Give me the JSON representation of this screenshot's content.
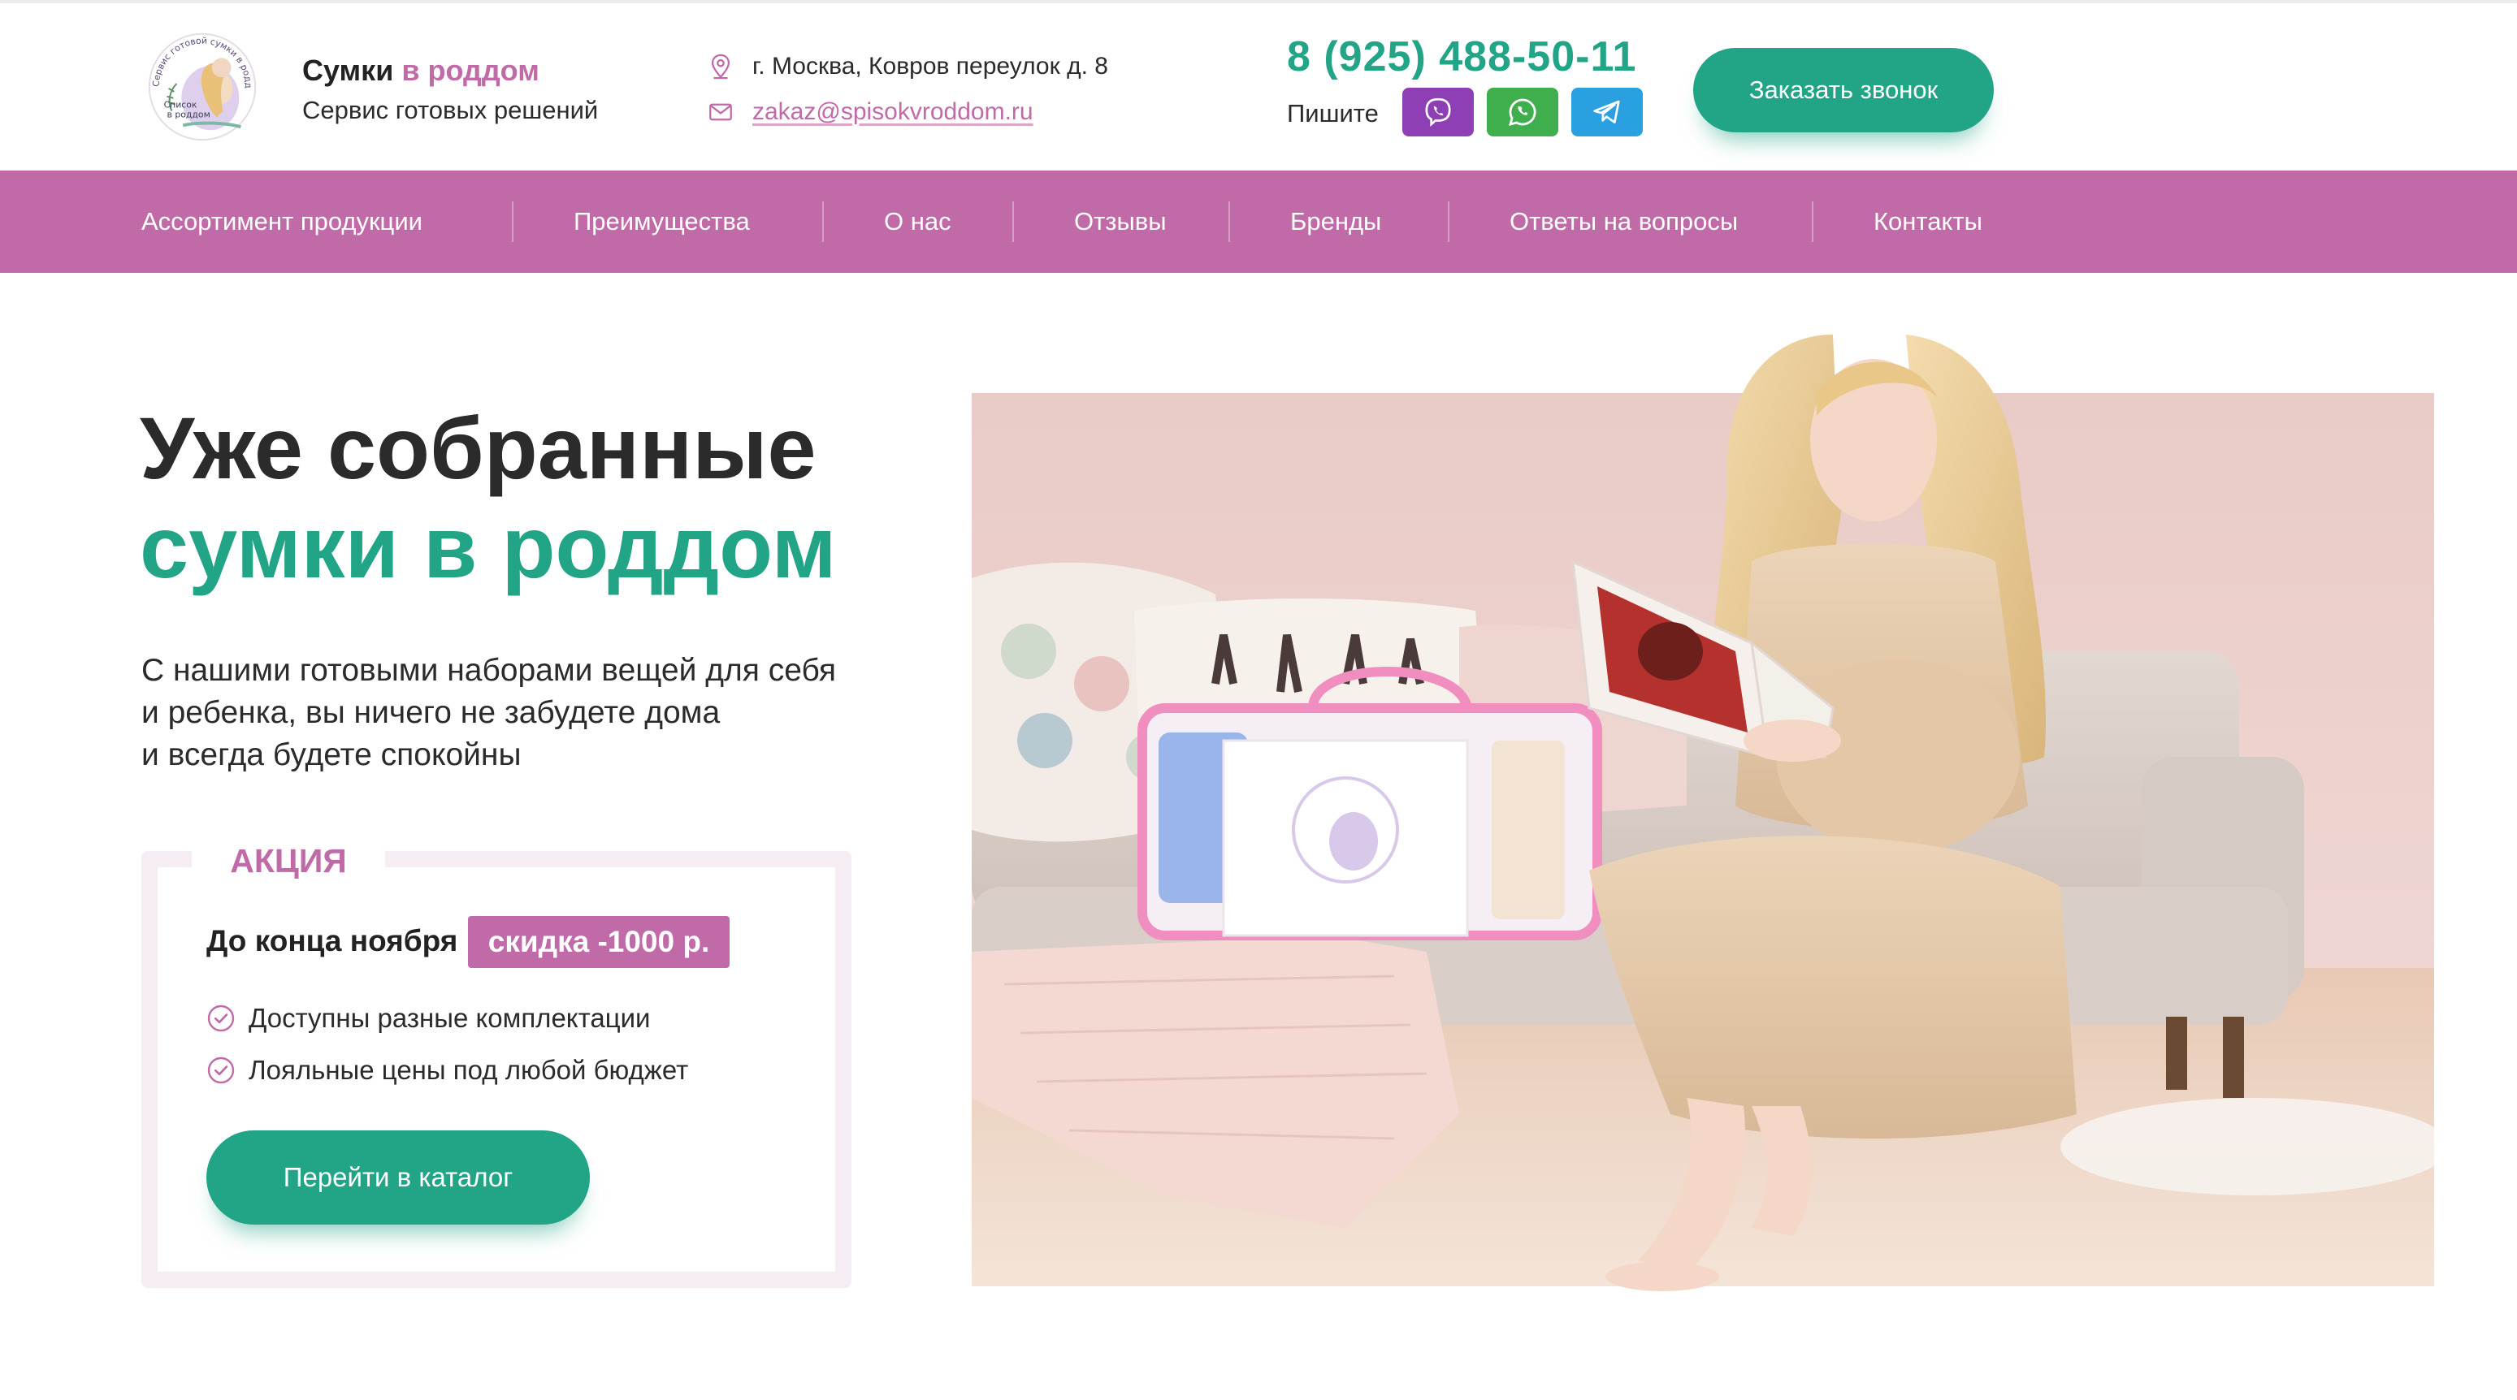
{
  "brand": {
    "name_part1": "Сумки",
    "name_part2": "в роддом",
    "tagline": "Сервис готовых решений",
    "emblem_text": "Сервис готовой сумки в роддом · Список в роддом"
  },
  "contacts": {
    "address": "г. Москва, Ковров переулок д. 8",
    "email": "zakaz@spisokvroddom.ru",
    "phone": "8 (925) 488-50-11",
    "write_label": "Пишите",
    "messengers": [
      "viber-icon",
      "whatsapp-icon",
      "telegram-icon"
    ]
  },
  "header": {
    "call_button": "Заказать звонок"
  },
  "nav": {
    "items": [
      {
        "label": "Ассортимент продукции"
      },
      {
        "label": "Преимущества"
      },
      {
        "label": "О нас"
      },
      {
        "label": "Отзывы"
      },
      {
        "label": "Бренды"
      },
      {
        "label": "Ответы на вопросы"
      },
      {
        "label": "Контакты"
      }
    ]
  },
  "hero": {
    "title_line1": "Уже собранные",
    "title_line2": "сумки в роддом",
    "lead": [
      "С нашими готовыми наборами вещей для себя",
      "и ребенка, вы ничего не забудете дома",
      "и всегда будете спокойны"
    ]
  },
  "promo": {
    "tag": "АКЦИЯ",
    "until": "До конца ноября",
    "discount": "скидка -1000 р.",
    "features": [
      "Доступны разные комплектации",
      "Лояльные цены под любой бюджет"
    ],
    "cta": "Перейти в каталог"
  },
  "colors": {
    "brand_pink": "#c16aa8",
    "brand_green": "#22a486",
    "viber": "#8e3fb3",
    "whatsapp": "#3fae4d",
    "telegram": "#2ba0e0"
  }
}
